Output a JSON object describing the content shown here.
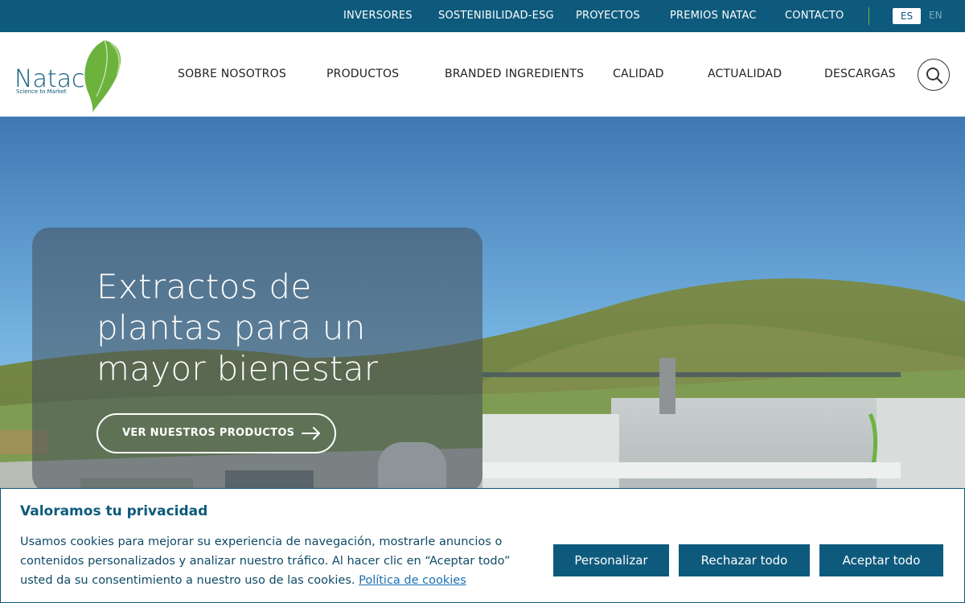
{
  "topbar": {
    "links": [
      "INVERSORES",
      "SOSTENIBILIDAD-ESG",
      "PROYECTOS",
      "PREMIOS NATAC",
      "CONTACTO"
    ],
    "lang_active": "ES",
    "lang_other": "EN"
  },
  "header": {
    "logo_text": "Natac",
    "logo_tagline": "Science to Market",
    "nav": [
      "SOBRE NOSOTROS",
      "PRODUCTOS",
      "BRANDED INGREDIENTS",
      "CALIDAD",
      "ACTUALIDAD",
      "DESCARGAS"
    ]
  },
  "hero": {
    "title": "Extractos de plantas para un mayor bienestar",
    "button_label": "VER NUESTROS PRODUCTOS"
  },
  "cookie": {
    "title": "Valoramos tu privacidad",
    "text": "Usamos cookies para mejorar su experiencia de navegación, mostrarle anuncios o contenidos personalizados y analizar nuestro tráfico. Al hacer clic en “Aceptar todo” usted da su consentimiento a nuestro uso de las cookies.",
    "link": "Política de cookies",
    "buttons": {
      "customize": "Personalizar",
      "reject": "Rechazar todo",
      "accept": "Aceptar todo"
    }
  },
  "colors": {
    "brand_blue": "#0e5a7c",
    "brand_green": "#7fb24a"
  },
  "icons": {
    "search": "search-icon",
    "arrow": "arrow-right-icon"
  }
}
